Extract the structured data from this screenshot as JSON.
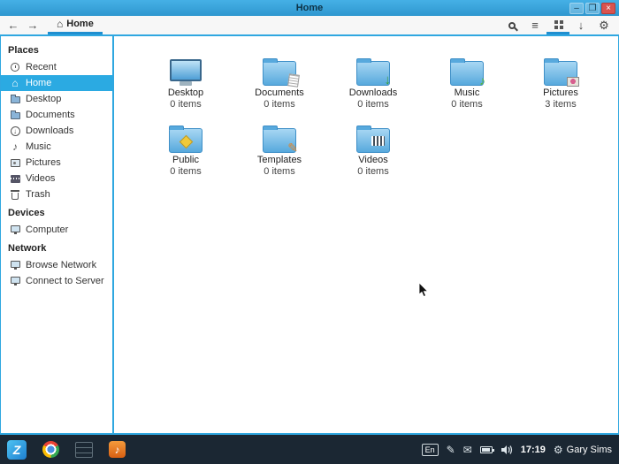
{
  "window": {
    "title": "Home",
    "controls": {
      "minimize": "–",
      "maximize": "❐",
      "close": "×"
    }
  },
  "toolbar": {
    "breadcrumb": "Home"
  },
  "icons": {
    "back": "←",
    "forward": "→",
    "home": "⌂",
    "list": "≡",
    "download": "↓",
    "gear": "⚙",
    "music_note": "♪",
    "pencil": "✎",
    "envelope": "✉",
    "down_arrow": "↓"
  },
  "sidebar": {
    "sections": [
      {
        "title": "Places",
        "items": [
          {
            "label": "Recent"
          },
          {
            "label": "Home",
            "selected": true
          },
          {
            "label": "Desktop"
          },
          {
            "label": "Documents"
          },
          {
            "label": "Downloads"
          },
          {
            "label": "Music"
          },
          {
            "label": "Pictures"
          },
          {
            "label": "Videos"
          },
          {
            "label": "Trash"
          }
        ]
      },
      {
        "title": "Devices",
        "items": [
          {
            "label": "Computer"
          }
        ]
      },
      {
        "title": "Network",
        "items": [
          {
            "label": "Browse Network"
          },
          {
            "label": "Connect to Server"
          }
        ]
      }
    ]
  },
  "files": [
    {
      "name": "Desktop",
      "count": "0 items"
    },
    {
      "name": "Documents",
      "count": "0 items"
    },
    {
      "name": "Downloads",
      "count": "0 items"
    },
    {
      "name": "Music",
      "count": "0 items"
    },
    {
      "name": "Pictures",
      "count": "3 items"
    },
    {
      "name": "Public",
      "count": "0 items"
    },
    {
      "name": "Templates",
      "count": "0 items"
    },
    {
      "name": "Videos",
      "count": "0 items"
    }
  ],
  "taskbar": {
    "logo_letter": "Z",
    "language": "En",
    "time": "17:19",
    "user": "Gary Sims"
  },
  "colors": {
    "accent": "#2fa7e0",
    "selection": "#2baae2",
    "titlebar": "#38a8dd",
    "taskbar_bg": "#1b2733"
  }
}
